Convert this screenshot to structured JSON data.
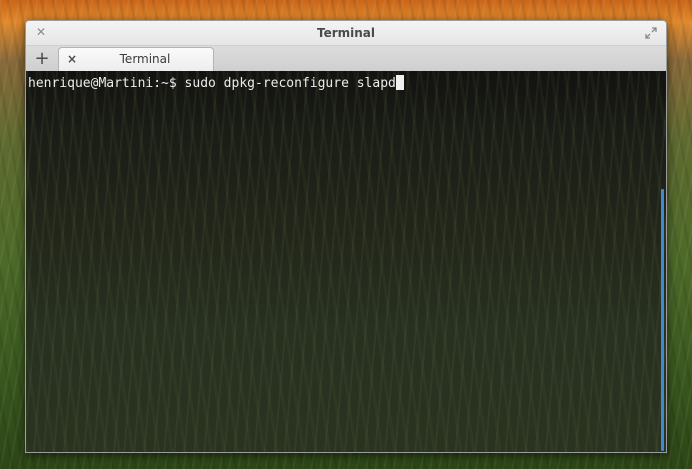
{
  "window": {
    "title": "Terminal"
  },
  "tabs": {
    "new_tab_label": "+",
    "items": [
      {
        "label": "Terminal",
        "close_label": "×"
      }
    ]
  },
  "terminal": {
    "prompt": "henrique@Martini:~$ ",
    "command": "sudo dpkg-reconfigure slapd"
  },
  "icons": {
    "window_close": "close-icon",
    "window_maximize": "maximize-icon"
  },
  "colors": {
    "scrollbar_accent": "#3b8bd8",
    "terminal_text": "#ececec"
  }
}
